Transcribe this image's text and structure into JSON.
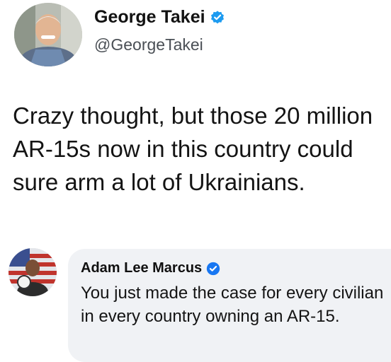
{
  "tweet": {
    "author_name": "George Takei",
    "author_handle": "@GeorgeTakei",
    "text": "Crazy thought, but those 20 million AR-15s now in this country could sure arm a lot of Ukrainians.",
    "avatar_icon": "profile-photo",
    "verified_icon": "verified-badge-icon",
    "verified_color": "#1d9bf0"
  },
  "reply": {
    "author_name": "Adam Lee Marcus",
    "text": "You just made the case for every civilian in every country owning an AR-15.",
    "avatar_icon": "profile-photo",
    "verified_icon": "verified-badge-icon",
    "verified_color": "#1877f2",
    "bubble_color": "#f0f2f5"
  }
}
